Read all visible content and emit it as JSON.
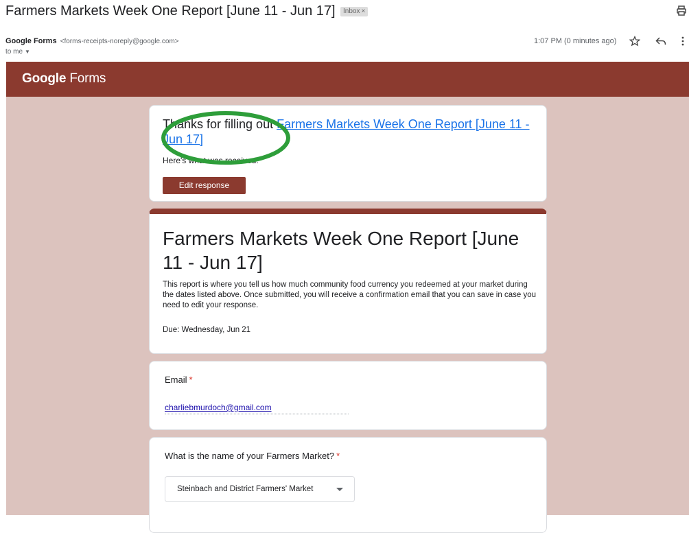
{
  "email": {
    "subject": "Farmers Markets Week One Report [June 11 - Jun 17]",
    "label": "Inbox",
    "label_close": "×",
    "sender_name": "Google Forms",
    "sender_address": "<forms-receipts-noreply@google.com>",
    "recipient": "to me",
    "time": "1:07 PM (0 minutes ago)"
  },
  "forms_banner": {
    "brand_google": "Google",
    "brand_forms": "Forms"
  },
  "confirmation": {
    "thanks_prefix": "Thanks for filling out ",
    "form_link": "Farmers Markets Week One Report [June 11 - Jun 17]",
    "received_text": "Here's what was received.",
    "edit_button": "Edit response"
  },
  "form": {
    "title": "Farmers Markets Week One Report [June 11 - Jun 17]",
    "description": "This report is where you tell us how much community food currency you redeemed at your market during the dates listed above. Once submitted, you will receive a confirmation email that you can save in case you need to edit your response.",
    "due": "Due: Wednesday, Jun 21"
  },
  "questions": [
    {
      "label": "Email",
      "required_mark": "*",
      "answer": "charliebmurdoch@gmail.com"
    },
    {
      "label": "What is the name of your Farmers Market?",
      "required_mark": "*",
      "answer": "Steinbach and District Farmers' Market"
    }
  ],
  "colors": {
    "brand": "#8b3a2f",
    "background": "#dcc3be",
    "link": "#1a73e8",
    "annotation_circle": "#2e9e3a"
  },
  "icons": [
    "print-icon",
    "star-icon",
    "reply-icon",
    "more-vert-icon",
    "chevron-down-icon",
    "dropdown-arrow-icon"
  ]
}
